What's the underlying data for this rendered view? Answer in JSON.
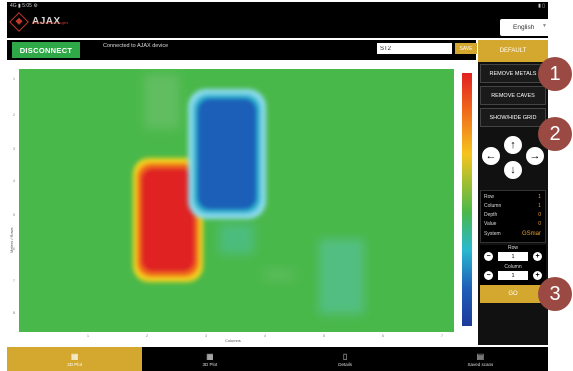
{
  "statusbar": {
    "left": "4G ▮ 5:05 ⚙",
    "right": "▮ ▯"
  },
  "header": {
    "logo_text": "AJAX",
    "logo_sub": "Detection Technologies",
    "language": "English"
  },
  "connection": {
    "disconnect_label": "DISCONNECT",
    "status_text": "Connected to AJAX device",
    "scan_name": "ST2",
    "save_label": "SAVE"
  },
  "chart": {
    "y_title": "Meters / Rows",
    "x_title": "Columns",
    "y_ticks": [
      "1",
      "2",
      "3",
      "4",
      "5",
      "6",
      "7",
      "8"
    ],
    "x_ticks": [
      "1",
      "2",
      "3",
      "4",
      "5",
      "6",
      "7"
    ]
  },
  "panel": {
    "default_label": "DEFAULT",
    "remove_metals_label": "REMOVE METALS",
    "remove_caves_label": "REMOVE CAVES",
    "show_hide_grid_label": "SHOW/HIDE GRID",
    "info": [
      {
        "label": "Row",
        "value": "1"
      },
      {
        "label": "Column",
        "value": "1"
      },
      {
        "label": "Depth",
        "value": "0"
      },
      {
        "label": "Value",
        "value": "0"
      },
      {
        "label": "System",
        "value": "GSmar"
      }
    ],
    "row_label": "Row",
    "row_value": "1",
    "column_label": "Column",
    "column_value": "1",
    "go_label": "GO"
  },
  "callouts": [
    "1",
    "2",
    "3"
  ],
  "nav": [
    {
      "label": "2D Plot",
      "icon": "▦"
    },
    {
      "label": "3D Plot",
      "icon": "▦"
    },
    {
      "label": "Details",
      "icon": "▯"
    },
    {
      "label": "Saved scans",
      "icon": "▤"
    }
  ],
  "colors": {
    "accent": "#d4a82e",
    "connect_green": "#2fa848",
    "field_green": "#49b84a",
    "anomaly_red": "#e02020",
    "anomaly_blue": "#1f5fb8",
    "callout": "#9a4a42"
  }
}
